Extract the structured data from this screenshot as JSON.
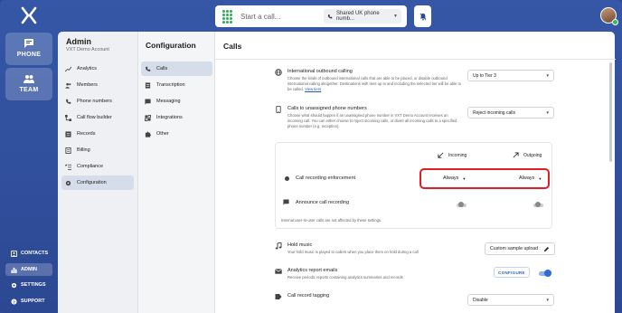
{
  "app": {
    "logo_icon": "x-logo-icon"
  },
  "topbar": {
    "start_call_placeholder": "Start a call...",
    "phone_number_select": "Shared UK phone numb...",
    "dnd_icon": "bell-off-icon"
  },
  "rail": {
    "phone_label": "PHONE",
    "team_label": "TEAM",
    "bottom": [
      {
        "label": "CONTACTS",
        "icon": "contacts-icon",
        "active": false
      },
      {
        "label": "ADMIN",
        "icon": "chart-icon",
        "active": true
      },
      {
        "label": "SETTINGS",
        "icon": "gear-icon",
        "active": false
      },
      {
        "label": "SUPPORT",
        "icon": "help-icon",
        "active": false
      }
    ]
  },
  "admin": {
    "title": "Admin",
    "account": "VXT Demo Account",
    "items": [
      {
        "label": "Analytics",
        "icon": "analytics-icon"
      },
      {
        "label": "Members",
        "icon": "members-icon"
      },
      {
        "label": "Phone numbers",
        "icon": "phone-icon"
      },
      {
        "label": "Call flow builder",
        "icon": "flow-icon"
      },
      {
        "label": "Records",
        "icon": "records-icon"
      },
      {
        "label": "Billing",
        "icon": "billing-icon"
      },
      {
        "label": "Compliance",
        "icon": "compliance-icon"
      },
      {
        "label": "Configuration",
        "icon": "gear-icon",
        "active": true
      }
    ]
  },
  "config": {
    "title": "Configuration",
    "items": [
      {
        "label": "Calls",
        "icon": "phone-icon",
        "active": true
      },
      {
        "label": "Transcription",
        "icon": "document-icon"
      },
      {
        "label": "Messaging",
        "icon": "message-icon"
      },
      {
        "label": "Integrations",
        "icon": "integration-icon"
      },
      {
        "label": "Other",
        "icon": "puzzle-icon"
      }
    ]
  },
  "calls": {
    "title": "Calls",
    "international": {
      "title": "International outbound calling",
      "desc": "Choose the kinds of outbound international calls that are able to be placed, or disable outbound international calling altogether. Destinations with tiers up to and including the selected tier will be able to be called.",
      "link": "View tiers",
      "value": "Up to Tier 3"
    },
    "unassigned": {
      "title": "Calls to unassigned phone numbers",
      "desc": "Choose what should happen if an unassigned phone number in VXT Demo Account receives an incoming call. You can either choose to reject incoming calls, or divert all incoming calls to a specified phone number (e.g. reception).",
      "value": "Reject incoming calls"
    },
    "recording_panel": {
      "incoming_label": "Incoming",
      "outgoing_label": "Outgoing",
      "enforcement_title": "Call recording enforcement",
      "incoming_value": "Always",
      "outgoing_value": "Always",
      "announce_title": "Announce call recording",
      "note": "Internal user-to-user calls are not affected by these settings."
    },
    "hold_music": {
      "title": "Hold music",
      "desc": "Your hold music is played to callers when you place them on hold during a call",
      "button": "Custom sample upload"
    },
    "analytics_emails": {
      "title": "Analytics report emails",
      "desc": "Receive periodic reports containing analytics summaries and records",
      "button": "CONFIGURE",
      "enabled": true
    },
    "record_tagging": {
      "title": "Call record tagging",
      "value": "Disable"
    }
  },
  "colors": {
    "highlight": "#e11d25",
    "accent": "#2f6ad6",
    "brand": "#3557a6"
  }
}
